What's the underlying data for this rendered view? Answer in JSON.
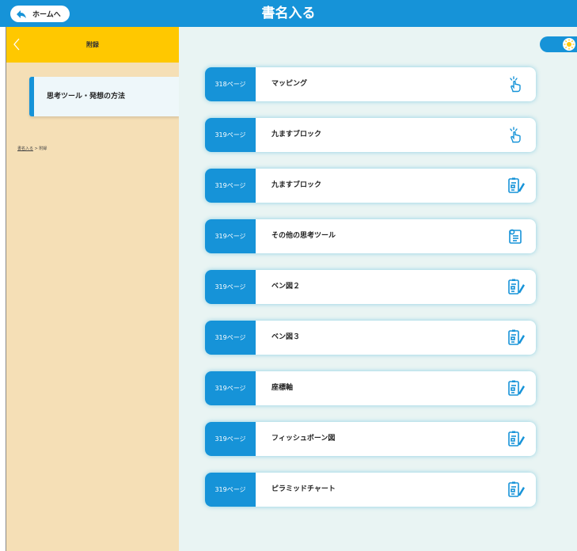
{
  "header": {
    "home_label": "ホームへ",
    "title": "書名入る"
  },
  "sidebar": {
    "title": "附録",
    "items": [
      {
        "label": "思考ツール・発想の方法"
      }
    ],
    "breadcrumb": {
      "link": "書名入る",
      "separator": " > ",
      "current": "附録"
    }
  },
  "colors": {
    "accent": "#1693d8",
    "sidebar_header": "#ffc800",
    "sidebar_bg": "#f5dfb6",
    "main_bg": "#e9f4f3"
  },
  "rows": [
    {
      "page": "318ページ",
      "title": "マッピング",
      "icon": "tap-hand-icon"
    },
    {
      "page": "319ページ",
      "title": "九ますブロック",
      "icon": "tap-hand-icon"
    },
    {
      "page": "319ページ",
      "title": "九ますブロック",
      "icon": "worksheet-edit-icon"
    },
    {
      "page": "319ページ",
      "title": "その他の思考ツール",
      "icon": "idea-list-icon"
    },
    {
      "page": "319ページ",
      "title": "ベン図２",
      "icon": "worksheet-edit-icon"
    },
    {
      "page": "319ページ",
      "title": "ベン図３",
      "icon": "worksheet-edit-icon"
    },
    {
      "page": "319ページ",
      "title": "座標軸",
      "icon": "worksheet-edit-icon"
    },
    {
      "page": "319ページ",
      "title": "フィッシュボーン図",
      "icon": "worksheet-edit-icon"
    },
    {
      "page": "319ページ",
      "title": "ピラミッドチャート",
      "icon": "worksheet-edit-icon"
    }
  ]
}
